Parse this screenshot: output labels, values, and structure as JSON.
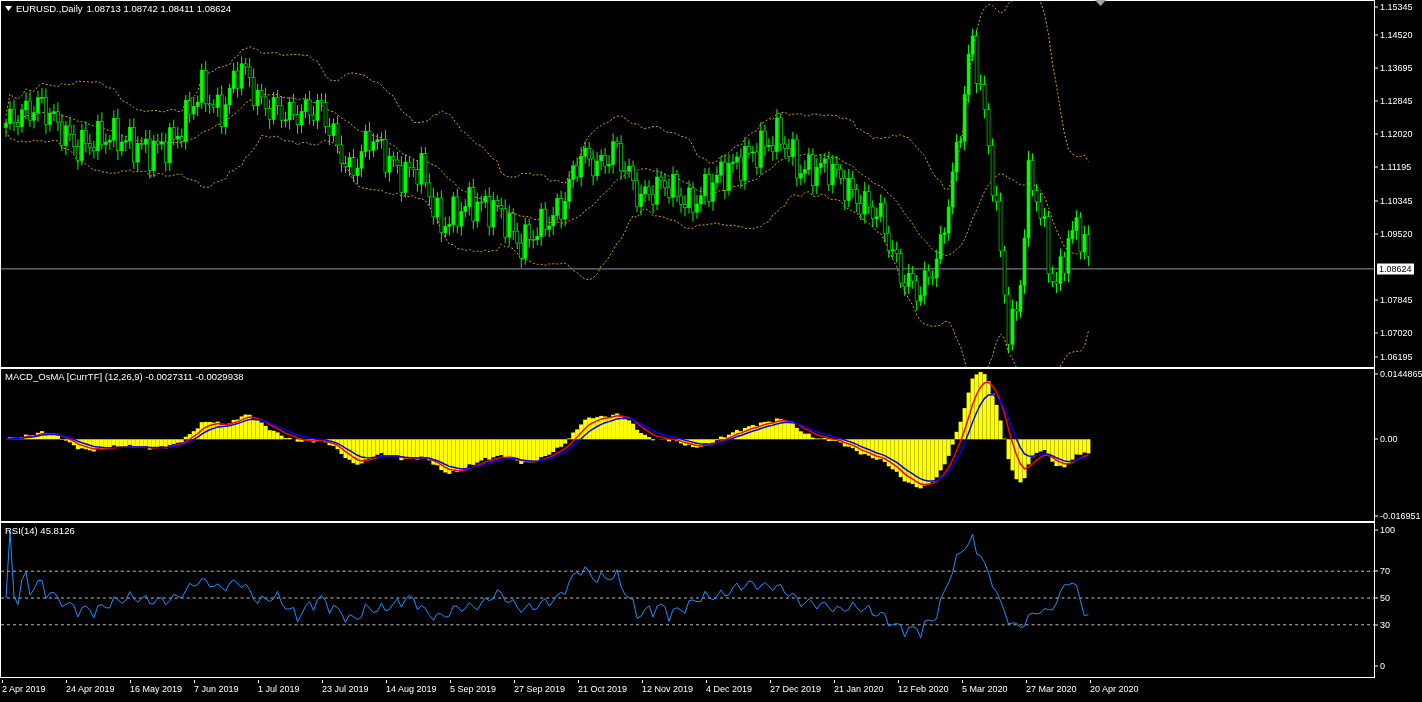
{
  "symbol": {
    "title": "EURUSD.,Daily",
    "ohlc": "1.08713 1.08742 1.08411 1.08624"
  },
  "price_axis": {
    "labels": [
      "1.15345",
      "1.14520",
      "1.13695",
      "1.12845",
      "1.12020",
      "1.11195",
      "1.10345",
      "1.09520",
      "1.07845",
      "1.07020",
      "1.06195"
    ],
    "current": "1.08624"
  },
  "macd": {
    "title": "MACD_OsMA [CurrTF] (12,26,9) -0.0027311 -0.0029938",
    "axis": [
      "0.0144865",
      "0.00",
      "-0.016951"
    ]
  },
  "rsi": {
    "title": "RSI(14) 45.8126",
    "axis": [
      "100",
      "70",
      "50",
      "30",
      "0"
    ]
  },
  "time_axis": [
    "2 Apr 2019",
    "24 Apr 2019",
    "16 May 2019",
    "7 Jun 2019",
    "1 Jul 2019",
    "23 Jul 2019",
    "14 Aug 2019",
    "5 Sep 2019",
    "27 Sep 2019",
    "21 Oct 2019",
    "12 Nov 2019",
    "4 Dec 2019",
    "27 Dec 2019",
    "21 Jan 2020",
    "12 Feb 2020",
    "5 Mar 2020",
    "27 Mar 2020",
    "20 Apr 2020"
  ]
}
